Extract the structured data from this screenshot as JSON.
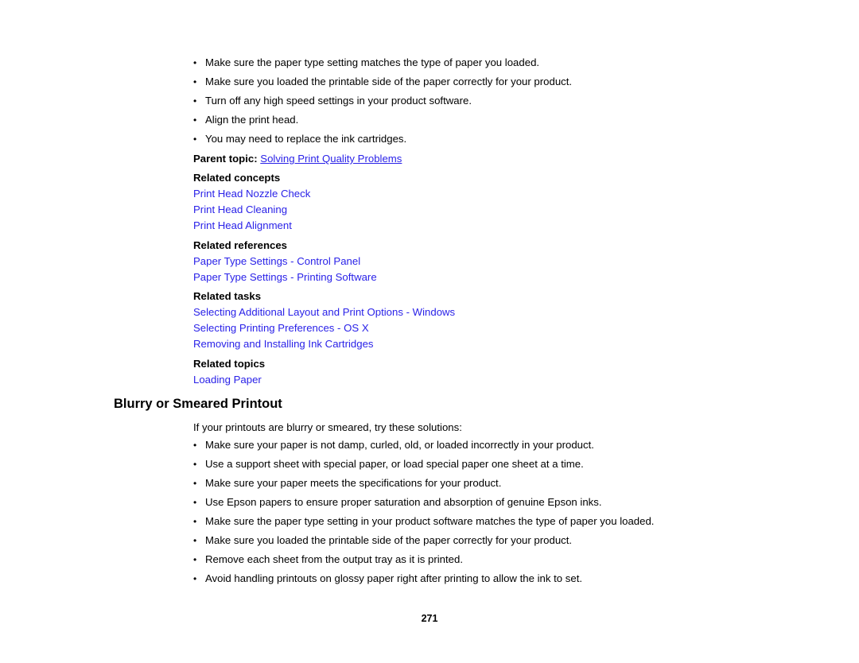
{
  "document": {
    "page_number": "271",
    "link_color": "#2a22e8",
    "text_color": "#000000",
    "background_color": "#ffffff"
  },
  "top_solutions": {
    "bullets": [
      "Make sure the paper type setting matches the type of paper you loaded.",
      "Make sure you loaded the printable side of the paper correctly for your product.",
      "Turn off any high speed settings in your product software.",
      "Align the print head.",
      "You may need to replace the ink cartridges."
    ]
  },
  "parent_topic": {
    "label": "Parent topic:",
    "link": "Solving Print Quality Problems"
  },
  "related_concepts": {
    "heading": "Related concepts",
    "links": [
      "Print Head Nozzle Check",
      "Print Head Cleaning",
      "Print Head Alignment"
    ]
  },
  "related_references": {
    "heading": "Related references",
    "links": [
      "Paper Type Settings - Control Panel",
      "Paper Type Settings - Printing Software"
    ]
  },
  "related_tasks": {
    "heading": "Related tasks",
    "links": [
      "Selecting Additional Layout and Print Options - Windows",
      "Selecting Printing Preferences - OS X",
      "Removing and Installing Ink Cartridges"
    ]
  },
  "related_topics": {
    "heading": "Related topics",
    "links": [
      "Loading Paper"
    ]
  },
  "blurry_section": {
    "heading": "Blurry or Smeared Printout",
    "intro": "If your printouts are blurry or smeared, try these solutions:",
    "bullets": [
      "Make sure your paper is not damp, curled, old, or loaded incorrectly in your product.",
      "Use a support sheet with special paper, or load special paper one sheet at a time.",
      "Make sure your paper meets the specifications for your product.",
      "Use Epson papers to ensure proper saturation and absorption of genuine Epson inks.",
      "Make sure the paper type setting in your product software matches the type of paper you loaded.",
      "Make sure you loaded the printable side of the paper correctly for your product.",
      "Remove each sheet from the output tray as it is printed.",
      "Avoid handling printouts on glossy paper right after printing to allow the ink to set."
    ]
  }
}
